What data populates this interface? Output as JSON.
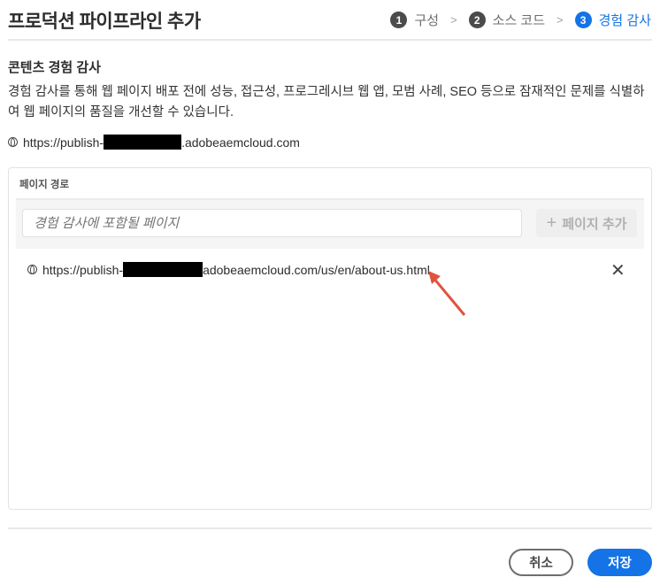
{
  "header": {
    "title": "프로덕션 파이프라인 추가",
    "steps": [
      {
        "num": "1",
        "label": "구성"
      },
      {
        "num": "2",
        "label": "소스 코드"
      },
      {
        "num": "3",
        "label": "경험 감사",
        "active": true
      }
    ]
  },
  "section": {
    "heading": "콘텐츠 경험 감사",
    "description": "경험 감사를 통해 웹 페이지 배포 전에 성능, 접근성, 프로그레시브 웹 앱, 모범 사례, SEO 등으로 잠재적인 문제를 식별하여 웹 페이지의 품질을 개선할 수 있습니다.",
    "host_prefix": "https://publish-",
    "host_suffix": ".adobeaemcloud.com"
  },
  "panel": {
    "label": "페이지 경로",
    "input_placeholder": "경험 감사에 포함될 페이지",
    "add_button": "페이지 추가",
    "add_icon": "+",
    "items": [
      {
        "prefix": "https://publish-",
        "suffix": "adobeaemcloud.com/us/en/about-us.html"
      }
    ],
    "remove_icon": "✕"
  },
  "footer": {
    "cancel": "취소",
    "save": "저장"
  },
  "colors": {
    "accent": "#1473e6",
    "annotation_arrow": "#e0533d"
  }
}
